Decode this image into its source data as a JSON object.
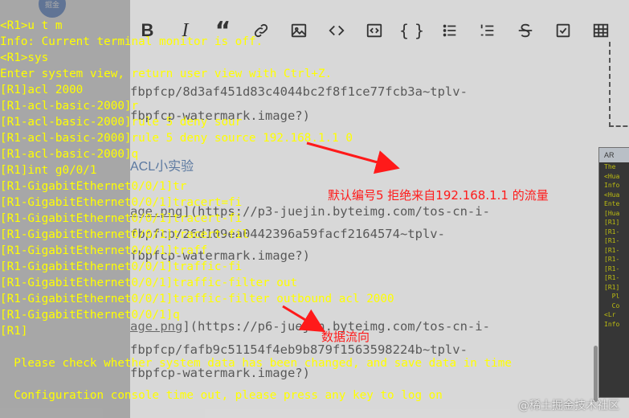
{
  "editor": {
    "avatar_text": "掘金",
    "toolbar": [
      {
        "name": "bold-icon",
        "glyph": "B"
      },
      {
        "name": "italic-icon",
        "glyph": "I"
      },
      {
        "name": "quote-icon",
        "glyph": "“"
      },
      {
        "name": "link-icon",
        "glyph": "🔗"
      },
      {
        "name": "image-icon",
        "glyph": "▣"
      },
      {
        "name": "code-icon",
        "glyph": "</>"
      },
      {
        "name": "code-block-icon",
        "glyph": "⌨"
      },
      {
        "name": "braces-icon",
        "glyph": "{ }"
      },
      {
        "name": "unordered-list-icon",
        "glyph": "☰"
      },
      {
        "name": "ordered-list-icon",
        "glyph": "≡"
      },
      {
        "name": "strikethrough-icon",
        "glyph": "S"
      },
      {
        "name": "checkbox-icon",
        "glyph": "☑"
      },
      {
        "name": "table-icon",
        "glyph": "▦"
      }
    ],
    "lines": {
      "l1": "fbpfcp/8d3af451d83c4044bc2f8f1ce77fcb3a~tplv-",
      "l2": "fbpfcp-watermark.image?)",
      "heading": "ACL小实验",
      "l3a": "age.png",
      "l3b": "](https://p3-juejin.byteimg.com/tos-cn-i-",
      "l4": "fbpfcp/26d109ea0442396a59facf2164574~tplv-",
      "l5": "fbpfcp-watermark.image?)",
      "l6a": "age.png",
      "l6b": "](https://p6-juejin.byteimg.com/tos-cn-i-",
      "l7": "fbpfcp/fafb9c51154f4eb9b879f1563598224b~tplv-",
      "l8": "fbpfcp-watermark.image?)"
    },
    "mini_title": "AR",
    "mini_lines": [
      "The",
      "",
      "<Hua",
      "Info",
      "<Hua",
      "Ente",
      "[Hua",
      "[R1]",
      "[R1-",
      "[R1-",
      "[R1-",
      "[R1-",
      "[R1-",
      "[R1-",
      "[R1]",
      "",
      "  Pl",
      "",
      "  Co",
      "",
      "<Lr",
      "Info"
    ]
  },
  "terminal": {
    "lines": [
      "<R1>u t m",
      "Info: Current terminal monitor is off.",
      "<R1>sys",
      "Enter system view, return user view with Ctrl+Z.",
      "[R1]acl 2000",
      "[R1-acl-basic-2000]r",
      "[R1-acl-basic-2000]rule 5 deny sour",
      "[R1-acl-basic-2000]rule 5 deny source 192.168.1.1 0",
      "[R1-acl-basic-2000]q",
      "[R1]int g0/0/1",
      "[R1-GigabitEthernet0/0/1]tr",
      "[R1-GigabitEthernet0/0/1]tracert=fi",
      "[R1-GigabitEthernet0/0/1]tracert-fi",
      "[R1-GigabitEthernet0/0/1]tracert-fil",
      "[R1-GigabitEthernet0/0/1]traff",
      "[R1-GigabitEthernet0/0/1]traffic-fi",
      "[R1-GigabitEthernet0/0/1]traffic-filter out",
      "[R1-GigabitEthernet0/0/1]traffic-filter outbound acl 2000",
      "[R1-GigabitEthernet0/0/1]q",
      "[R1]",
      "",
      "  Please check whether system data has been changed, and save data in time",
      "",
      "  Configuration console time out, please press any key to log on"
    ]
  },
  "annotations": {
    "a1": "默认编号5 拒绝来自192.168.1.1 的流量",
    "a2": "数据流向"
  },
  "watermark": "@稀土掘金技术社区",
  "colors": {
    "terminal_text": "#ffff00",
    "annotation": "#ff1a1a",
    "heading_link": "#5b7fb0"
  }
}
